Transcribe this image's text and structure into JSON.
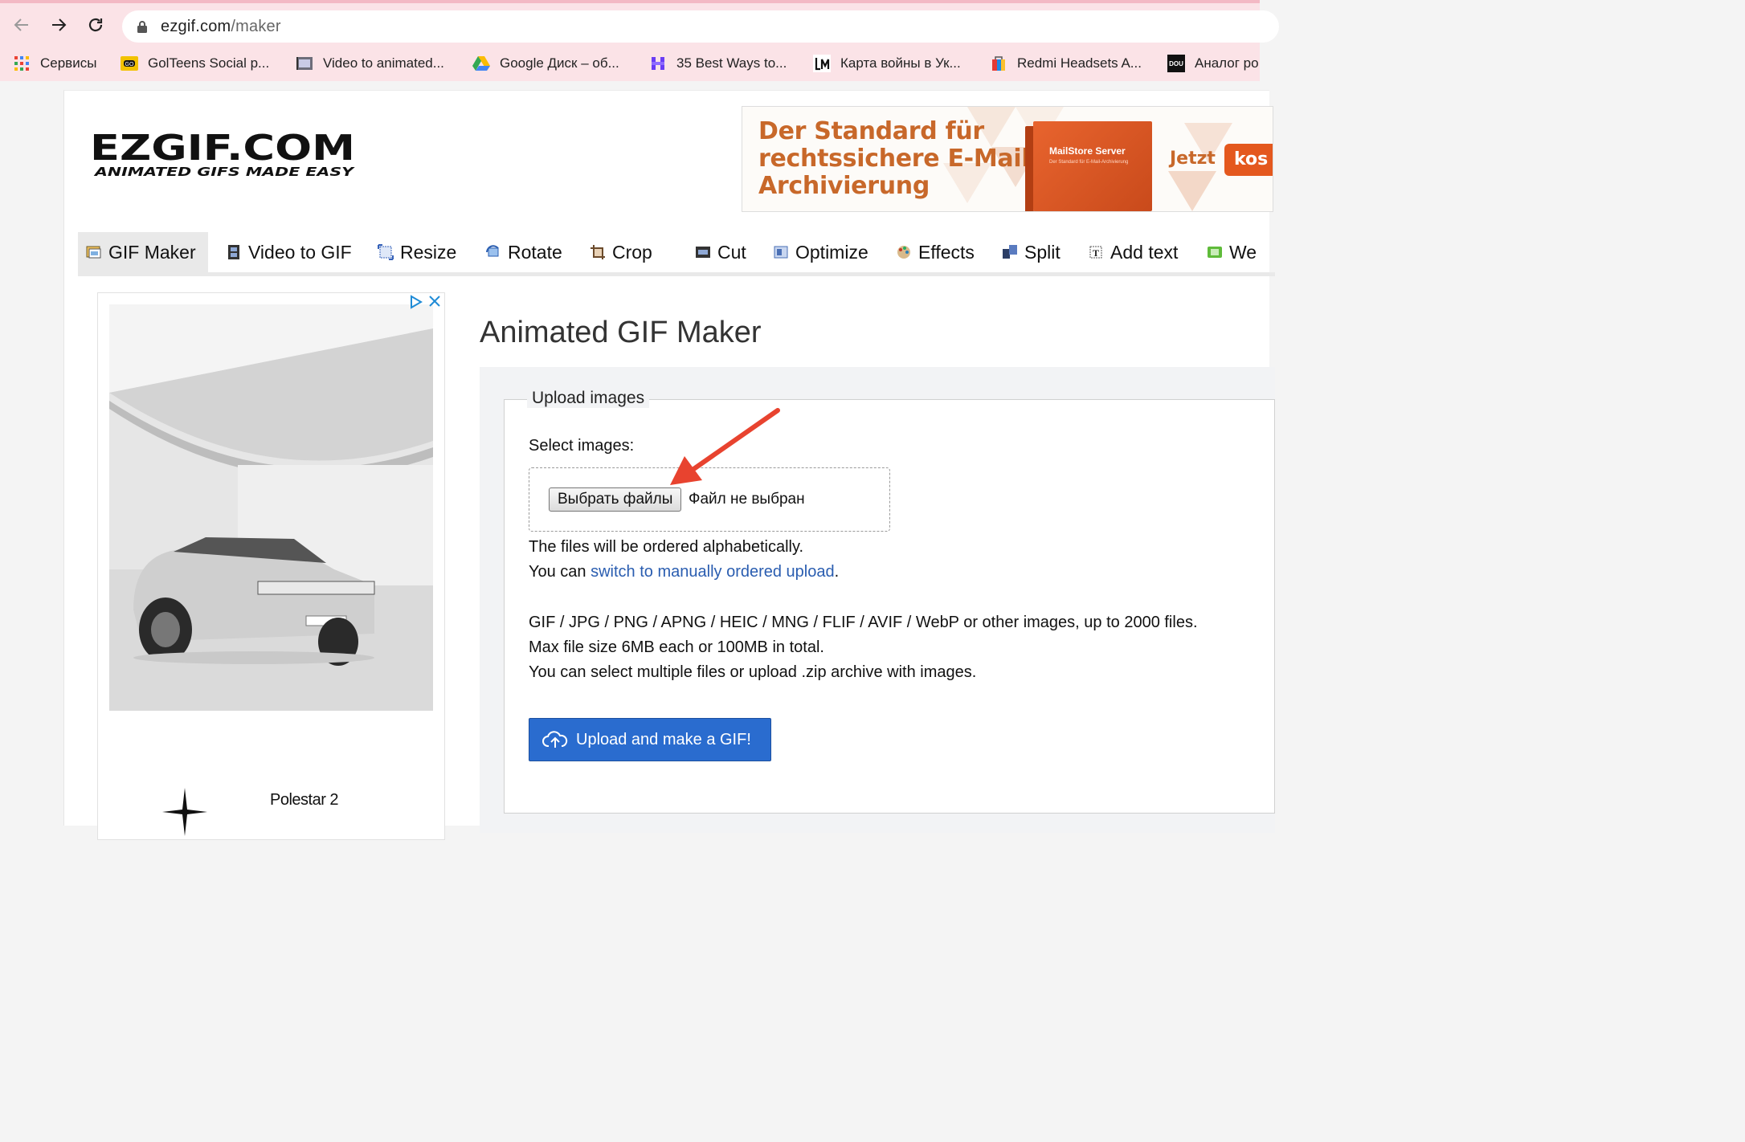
{
  "browser": {
    "url_domain": "ezgif.com",
    "url_path": "/maker",
    "bookmarks": [
      {
        "label": "Сервисы",
        "icon": "apps-grid-icon"
      },
      {
        "label": "GolTeens Social p...",
        "icon": "golteens-icon"
      },
      {
        "label": "Video to animated...",
        "icon": "video-to-gif-icon"
      },
      {
        "label": "Google Диск – об...",
        "icon": "google-drive-icon"
      },
      {
        "label": "35 Best Ways to...",
        "icon": "purple-h-icon"
      },
      {
        "label": "Карта войны в Ук...",
        "icon": "liveuamap-icon"
      },
      {
        "label": "Redmi Headsets A...",
        "icon": "shopping-bag-icon"
      },
      {
        "label": "Аналог ро",
        "icon": "dou-icon"
      }
    ]
  },
  "site": {
    "logo_main": "EZGIF.COM",
    "logo_tagline": "ANIMATED GIFS MADE EASY"
  },
  "banner_ad": {
    "headline_lines": [
      "Der Standard für",
      "rechtssichere E-Mail-",
      "Archivierung"
    ],
    "product": "MailStore Server",
    "product_sub": "Der Standard für E-Mail-Archivierung",
    "cta_prefix": "Jetzt",
    "cta_button": "kos"
  },
  "menu": {
    "tabs": [
      {
        "label": "GIF Maker",
        "icon": "gif-maker-icon",
        "active": true
      },
      {
        "label": "Video to GIF",
        "icon": "film-icon"
      },
      {
        "label": "Resize",
        "icon": "resize-icon"
      },
      {
        "label": "Rotate",
        "icon": "rotate-icon"
      },
      {
        "label": "Crop",
        "icon": "crop-icon"
      },
      {
        "label": "Cut",
        "icon": "cut-icon"
      },
      {
        "label": "Optimize",
        "icon": "optimize-icon"
      },
      {
        "label": "Effects",
        "icon": "effects-palette-icon"
      },
      {
        "label": "Split",
        "icon": "split-icon"
      },
      {
        "label": "Add text",
        "icon": "add-text-icon"
      },
      {
        "label": "We",
        "icon": "webp-icon"
      }
    ]
  },
  "side_ad": {
    "brand": "Polestar 2"
  },
  "main": {
    "title": "Animated GIF Maker",
    "legend": "Upload images",
    "select_label": "Select images:",
    "file_button": "Выбрать файлы",
    "file_status": "Файл не выбран",
    "order_note": "The files will be ordered alphabetically.",
    "switch_prefix": "You can ",
    "switch_link": "switch to manually ordered upload",
    "switch_suffix": ".",
    "formats": "GIF / JPG / PNG / APNG / HEIC / MNG / FLIF / AVIF / WebP or other images, up to 2000 files.",
    "max_size": "Max file size 6MB each or 100MB in total.",
    "multi_note": "You can select multiple files or upload .zip archive with images.",
    "upload_button": "Upload and make a GIF!"
  },
  "colors": {
    "chrome_bg": "#fbe3e7",
    "upload_button": "#2a6ccf",
    "link": "#2a5db0",
    "annotation_arrow": "#e8432f",
    "banner_orange": "#e4581e"
  }
}
